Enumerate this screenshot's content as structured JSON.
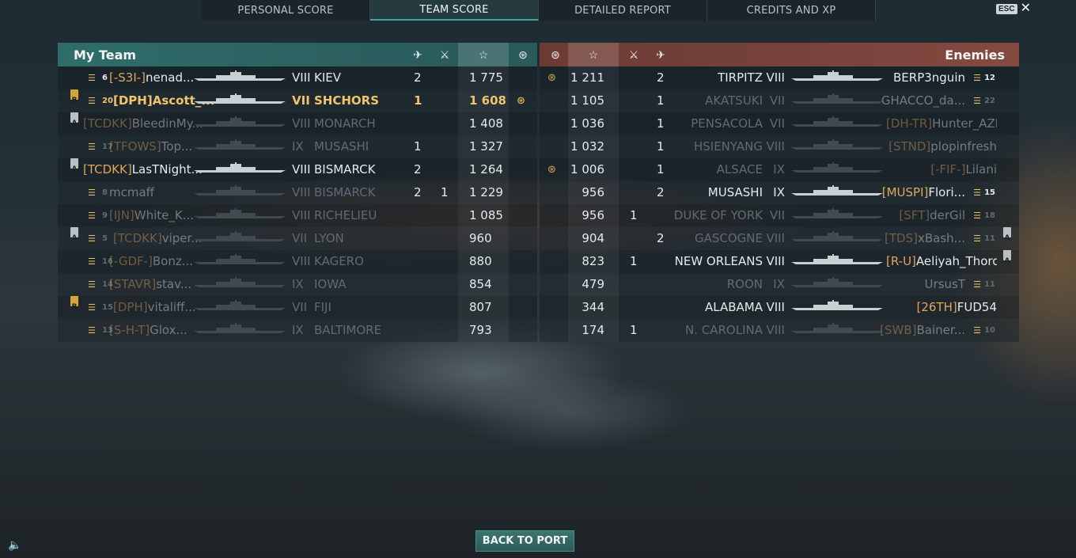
{
  "tabs": [
    {
      "label": "PERSONAL SCORE",
      "active": false
    },
    {
      "label": "TEAM SCORE",
      "active": true
    },
    {
      "label": "DETAILED REPORT",
      "active": false
    },
    {
      "label": "CREDITS AND XP",
      "active": false
    }
  ],
  "esc_label": "ESC",
  "back_label": "BACK TO PORT",
  "my_team": {
    "title": "My Team",
    "rows": [
      {
        "rank": "6",
        "clan": "[-S3I-]",
        "name": "nenad...",
        "tier": "VIII",
        "ship": "KIEV",
        "planes": "2",
        "frags": "",
        "score": "1 775",
        "ribbon": false,
        "division": "",
        "alive": true,
        "self": false
      },
      {
        "rank": "20",
        "clan": "[DPH]",
        "name": "Ascott_...",
        "tier": "VII",
        "ship": "SHCHORS",
        "planes": "1",
        "frags": "",
        "score": "1 608",
        "ribbon": true,
        "division": "B",
        "alive": true,
        "self": true
      },
      {
        "rank": "",
        "clan": "[TCDKK]",
        "name": "BleedinMy...",
        "tier": "VIII",
        "ship": "MONARCH",
        "planes": "",
        "frags": "",
        "score": "1 408",
        "ribbon": false,
        "division": "A",
        "alive": false,
        "self": false
      },
      {
        "rank": "17",
        "clan": "[TFOWS]",
        "name": "Top...",
        "tier": "IX",
        "ship": "MUSASHI",
        "planes": "1",
        "frags": "",
        "score": "1 327",
        "ribbon": false,
        "division": "",
        "alive": false,
        "self": false
      },
      {
        "rank": "",
        "clan": "[TCDKK]",
        "name": "LasTNight...",
        "tier": "VIII",
        "ship": "BISMARCK",
        "planes": "2",
        "frags": "",
        "score": "1 264",
        "ribbon": false,
        "division": "A",
        "alive": true,
        "self": false
      },
      {
        "rank": "8",
        "clan": "",
        "name": "mcmaff",
        "tier": "VIII",
        "ship": "BISMARCK",
        "planes": "2",
        "frags": "1",
        "score": "1 229",
        "ribbon": false,
        "division": "",
        "alive": false,
        "self": false
      },
      {
        "rank": "9",
        "clan": "[IJN]",
        "name": "White_K...",
        "tier": "VIII",
        "ship": "RICHELIEU",
        "planes": "",
        "frags": "",
        "score": "1 085",
        "ribbon": false,
        "division": "",
        "alive": false,
        "self": false
      },
      {
        "rank": "5",
        "clan": "[TCDKK]",
        "name": "viper...",
        "tier": "VII",
        "ship": "LYON",
        "planes": "",
        "frags": "",
        "score": "960",
        "ribbon": false,
        "division": "A",
        "alive": false,
        "self": false
      },
      {
        "rank": "16",
        "clan": "[-GDF-]",
        "name": "Bonz...",
        "tier": "VIII",
        "ship": "KAGERO",
        "planes": "",
        "frags": "",
        "score": "880",
        "ribbon": false,
        "division": "",
        "alive": false,
        "self": false
      },
      {
        "rank": "14",
        "clan": "[STAVR]",
        "name": "stav...",
        "tier": "IX",
        "ship": "IOWA",
        "planes": "",
        "frags": "",
        "score": "854",
        "ribbon": false,
        "division": "",
        "alive": false,
        "self": false
      },
      {
        "rank": "15",
        "clan": "[DPH]",
        "name": "vitaliff...",
        "tier": "VII",
        "ship": "FIJI",
        "planes": "",
        "frags": "",
        "score": "807",
        "ribbon": false,
        "division": "B",
        "alive": false,
        "self": false
      },
      {
        "rank": "13",
        "clan": "[S-H-T]",
        "name": "Glox...",
        "tier": "IX",
        "ship": "BALTIMORE",
        "planes": "",
        "frags": "",
        "score": "793",
        "ribbon": false,
        "division": "",
        "alive": false,
        "self": false
      }
    ]
  },
  "enemies": {
    "title": "Enemies",
    "rows": [
      {
        "ribbon": true,
        "score": "1 211",
        "frags": "",
        "planes": "2",
        "ship": "TIRPITZ",
        "tier": "VIII",
        "clan": "",
        "name": "BERP3nguin",
        "rank": "12",
        "division": "",
        "alive": true
      },
      {
        "ribbon": false,
        "score": "1 105",
        "frags": "",
        "planes": "1",
        "ship": "AKATSUKI",
        "tier": "VII",
        "clan": "",
        "name": "GHACCO_da...",
        "rank": "22",
        "division": "",
        "alive": false
      },
      {
        "ribbon": false,
        "score": "1 036",
        "frags": "",
        "planes": "1",
        "ship": "PENSACOLA",
        "tier": "VII",
        "clan": "[DH-TR]",
        "name": "Hunter_AZE",
        "rank": "",
        "division": "",
        "alive": false
      },
      {
        "ribbon": false,
        "score": "1 032",
        "frags": "",
        "planes": "1",
        "ship": "HSIENYANG",
        "tier": "VIII",
        "clan": "[STND]",
        "name": "plopinfresh",
        "rank": "",
        "division": "",
        "alive": false
      },
      {
        "ribbon": true,
        "score": "1 006",
        "frags": "",
        "planes": "1",
        "ship": "ALSACE",
        "tier": "IX",
        "clan": "[-FIF-]",
        "name": "Lilani",
        "rank": "",
        "division": "",
        "alive": false
      },
      {
        "ribbon": false,
        "score": "956",
        "frags": "",
        "planes": "2",
        "ship": "MUSASHI",
        "tier": "IX",
        "clan": "[MUSPI]",
        "name": "Flori...",
        "rank": "15",
        "division": "",
        "alive": true
      },
      {
        "ribbon": false,
        "score": "956",
        "frags": "1",
        "planes": "",
        "ship": "DUKE OF YORK",
        "tier": "VII",
        "clan": "[SFT]",
        "name": "derGil",
        "rank": "18",
        "division": "",
        "alive": false
      },
      {
        "ribbon": false,
        "score": "904",
        "frags": "",
        "planes": "2",
        "ship": "GASCOGNE",
        "tier": "VIII",
        "clan": "[TDS]",
        "name": "xBash...",
        "rank": "11",
        "division": "A",
        "alive": false
      },
      {
        "ribbon": false,
        "score": "823",
        "frags": "1",
        "planes": "",
        "ship": "NEW ORLEANS",
        "tier": "VIII",
        "clan": "[R-U]",
        "name": "Aeliyah_Thord",
        "rank": "",
        "division": "A",
        "alive": true
      },
      {
        "ribbon": false,
        "score": "479",
        "frags": "",
        "planes": "",
        "ship": "ROON",
        "tier": "IX",
        "clan": "",
        "name": "UrsusT",
        "rank": "11",
        "division": "",
        "alive": false
      },
      {
        "ribbon": false,
        "score": "344",
        "frags": "",
        "planes": "",
        "ship": "ALABAMA",
        "tier": "VIII",
        "clan": "[26TH]",
        "name": "FUD54",
        "rank": "",
        "division": "",
        "alive": true
      },
      {
        "ribbon": false,
        "score": "174",
        "frags": "1",
        "planes": "",
        "ship": "N. CAROLINA",
        "tier": "VIII",
        "clan": "[SWB]",
        "name": "Bainer...",
        "rank": "10",
        "division": "",
        "alive": false
      }
    ]
  }
}
